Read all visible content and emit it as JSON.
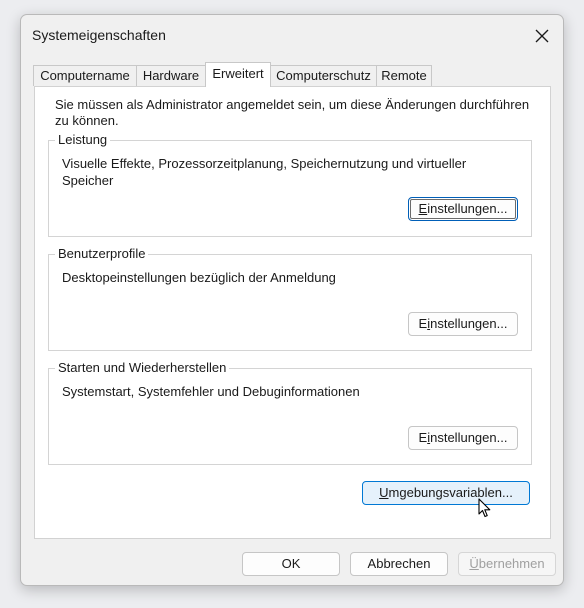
{
  "window": {
    "title": "Systemeigenschaften"
  },
  "tabs": [
    {
      "label": "Computername",
      "active": false
    },
    {
      "label": "Hardware",
      "active": false
    },
    {
      "label": "Erweitert",
      "active": true
    },
    {
      "label": "Computerschutz",
      "active": false
    },
    {
      "label": "Remote",
      "active": false
    }
  ],
  "info_text": "Sie müssen als Administrator angemeldet sein, um diese Änderungen durchführen zu können.",
  "groups": [
    {
      "title": "Leistung",
      "description": "Visuelle Effekte, Prozessorzeitplanung, Speichernutzung und virtueller Speicher",
      "button_first": "E",
      "button_rest": "instellungen..."
    },
    {
      "title": "Benutzerprofile",
      "description": "Desktopeinstellungen bezüglich der Anmeldung",
      "button_first": "E",
      "button_pre": "E",
      "button_ul": "i",
      "button_rest": "nstellungen..."
    },
    {
      "title": "Starten und Wiederherstellen",
      "description": "Systemstart, Systemfehler und Debuginformationen",
      "button_pre": "E",
      "button_ul": "i",
      "button_rest": "nstellungen..."
    }
  ],
  "env_button": {
    "ul": "U",
    "rest": "mgebungsvariablen..."
  },
  "footer": {
    "ok": "OK",
    "cancel": "Abbrechen",
    "apply_ul": "Ü",
    "apply_rest": "bernehmen"
  },
  "colors": {
    "focus_border": "#005fb8",
    "hover_border": "#0078d4",
    "hover_bg": "#e5f1fb"
  }
}
